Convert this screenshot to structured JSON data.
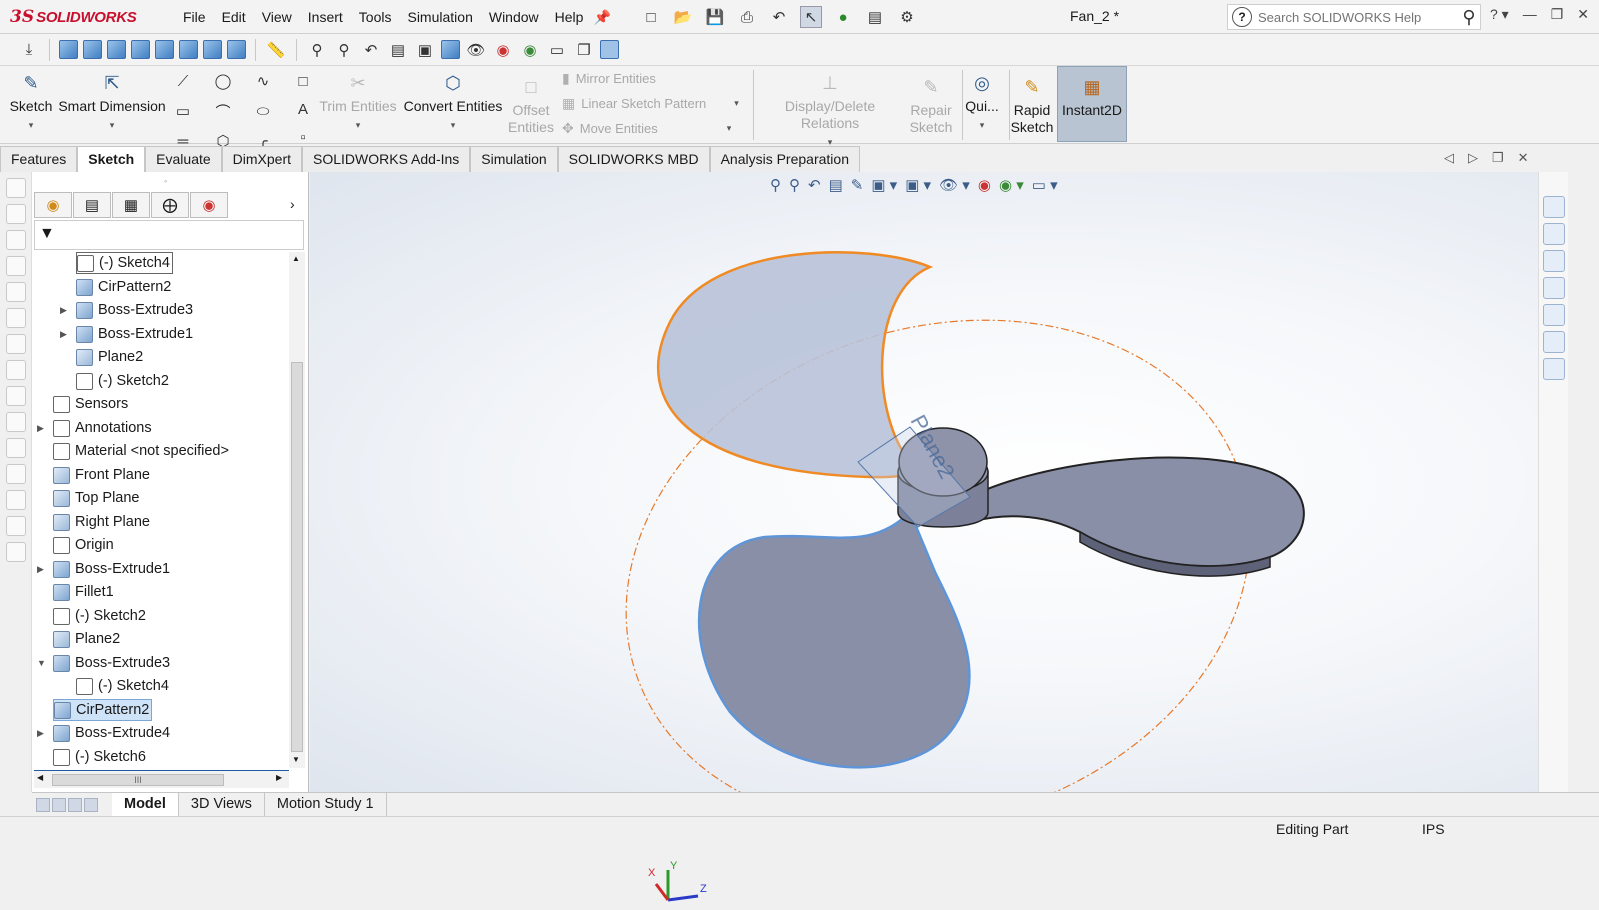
{
  "app": {
    "logo_prefix": "3S",
    "logo_text": "SOLIDWORKS",
    "document_title": "Fan_2 *"
  },
  "menu": [
    "File",
    "Edit",
    "View",
    "Insert",
    "Tools",
    "Simulation",
    "Window",
    "Help"
  ],
  "search": {
    "placeholder": "Search SOLIDWORKS Help"
  },
  "sketch_tools": {
    "sketch": "Sketch",
    "smart_dimension": "Smart Dimension",
    "trim_entities": "Trim Entities",
    "convert_entities": "Convert Entities",
    "offset_entities_1": "Offset",
    "offset_entities_2": "Entities",
    "mirror_entities": "Mirror Entities",
    "linear_sketch_pattern": "Linear Sketch Pattern",
    "move_entities": "Move Entities",
    "display_delete_relations": "Display/Delete Relations",
    "repair_sketch_1": "Repair",
    "repair_sketch_2": "Sketch",
    "quick_snaps": "Qui...",
    "rapid_sketch_1": "Rapid",
    "rapid_sketch_2": "Sketch",
    "instant2d": "Instant2D"
  },
  "command_tabs": [
    "Features",
    "Sketch",
    "Evaluate",
    "DimXpert",
    "SOLIDWORKS Add-Ins",
    "Simulation",
    "SOLIDWORKS MBD",
    "Analysis Preparation"
  ],
  "active_command_tab": "Sketch",
  "feature_tree": [
    {
      "label": "(-) Sketch4"
    },
    {
      "label": "CirPattern2"
    },
    {
      "label": "Boss-Extrude3"
    },
    {
      "label": "Boss-Extrude1"
    },
    {
      "label": "Plane2"
    },
    {
      "label": "(-) Sketch2"
    },
    {
      "label": "Sensors"
    },
    {
      "label": "Annotations"
    },
    {
      "label": "Material <not specified>"
    },
    {
      "label": "Front Plane"
    },
    {
      "label": "Top Plane"
    },
    {
      "label": "Right Plane"
    },
    {
      "label": "Origin"
    },
    {
      "label": "Boss-Extrude1"
    },
    {
      "label": "Fillet1"
    },
    {
      "label": "(-) Sketch2"
    },
    {
      "label": "Plane2"
    },
    {
      "label": "Boss-Extrude3"
    },
    {
      "label": "(-) Sketch4"
    },
    {
      "label": "CirPattern2"
    },
    {
      "label": "Boss-Extrude4"
    },
    {
      "label": "(-) Sketch6"
    }
  ],
  "scrollbar_grip": "III",
  "viewport": {
    "plane_label": "Plane2",
    "triad": {
      "x": "X",
      "y": "Y",
      "z": "Z"
    }
  },
  "bottom_tabs": [
    "Model",
    "3D Views",
    "Motion Study 1"
  ],
  "status": {
    "mode": "Editing Part",
    "units": "IPS"
  }
}
